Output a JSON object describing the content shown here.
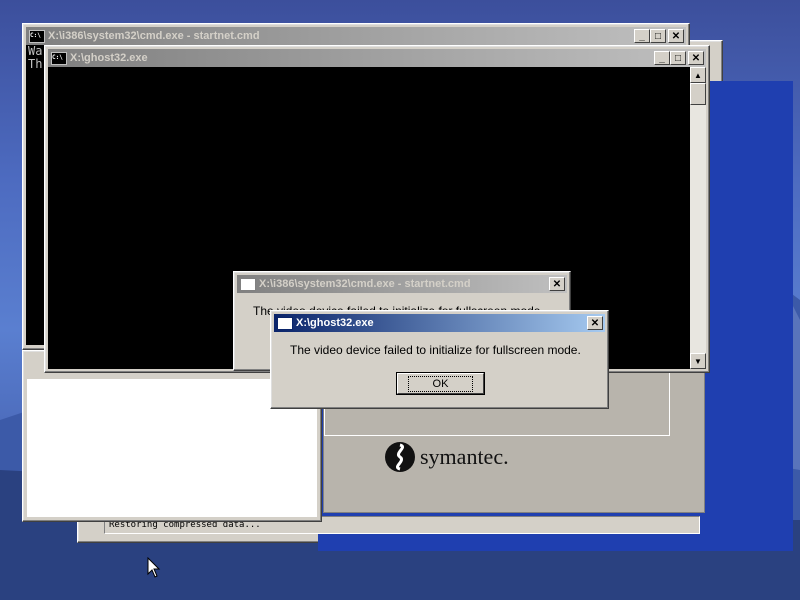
{
  "windows": {
    "cmd_back": {
      "title": "X:\\i386\\system32\\cmd.exe - startnet.cmd",
      "console_lines": [
        "Wa",
        "Th"
      ]
    },
    "ghost_main": {
      "title": "X:\\ghost32.exe"
    },
    "ghost_progress": {
      "status": "Restoring compressed data...",
      "brand": "symantec."
    },
    "cmd_dialog": {
      "title": "X:\\i386\\system32\\cmd.exe - startnet.cmd",
      "message": "The video device failed to initialize for fullscreen mode."
    },
    "ghost_dialog": {
      "title": "X:\\ghost32.exe",
      "message": "The video device failed to initialize for fullscreen mode.",
      "ok_label": "OK"
    }
  },
  "icons": {
    "console": "C:\\",
    "window": "window-icon"
  },
  "colors": {
    "desktop": "#4d6bc0",
    "active_title": "#0a246a",
    "inactive_title": "#808080",
    "ghost_blue": "#1f3fb0"
  }
}
